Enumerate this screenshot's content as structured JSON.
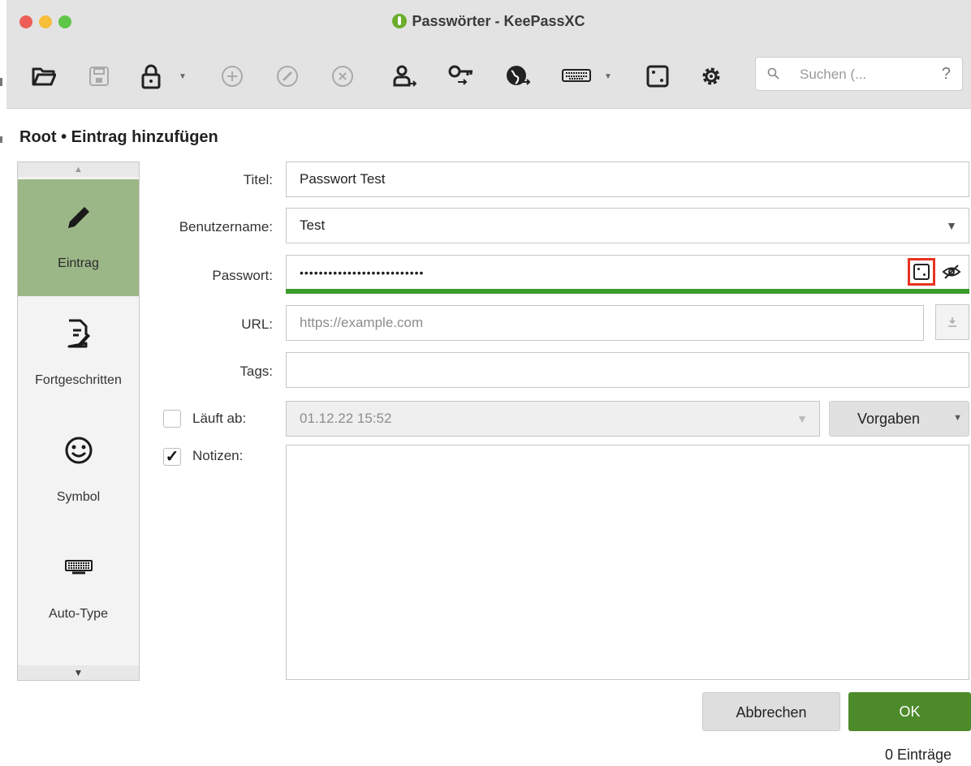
{
  "window": {
    "title": "Passwörter - KeePassXC"
  },
  "toolbar": {
    "icons": [
      "open-database-icon",
      "save-database-icon",
      "lock-database-icon",
      "add-entry-icon",
      "edit-entry-icon",
      "delete-entry-icon",
      "copy-username-icon",
      "copy-password-icon",
      "copy-url-icon",
      "autotype-icon",
      "password-generator-icon",
      "settings-icon"
    ],
    "search_placeholder": "Suchen (...",
    "search_help": "?"
  },
  "breadcrumb": "Root • Eintrag hinzufügen",
  "categories": [
    {
      "label": "Eintrag",
      "icon": "pencil-icon",
      "active": true
    },
    {
      "label": "Fortgeschritten",
      "icon": "document-edit-icon",
      "active": false
    },
    {
      "label": "Symbol",
      "icon": "smiley-icon",
      "active": false
    },
    {
      "label": "Auto-Type",
      "icon": "keyboard-icon",
      "active": false
    }
  ],
  "form": {
    "title_label": "Titel:",
    "title_value": "Passwort Test",
    "username_label": "Benutzername:",
    "username_value": "Test",
    "password_label": "Passwort:",
    "password_value": "••••••••••••••••••••••••••",
    "url_label": "URL:",
    "url_placeholder": "https://example.com",
    "tags_label": "Tags:",
    "tags_value": "",
    "expires_label": "Läuft ab:",
    "expires_checked": false,
    "expires_value": "01.12.22 15:52",
    "presets_label": "Vorgaben",
    "notes_label": "Notizen:",
    "notes_checked": true,
    "notes_value": ""
  },
  "buttons": {
    "cancel": "Abbrechen",
    "ok": "OK"
  },
  "status": "0 Einträge",
  "colors": {
    "active_category": "#9cb787",
    "ok_button": "#4d8a2a",
    "password_strength": "#3a9a2a",
    "highlight": "#e8321f"
  }
}
